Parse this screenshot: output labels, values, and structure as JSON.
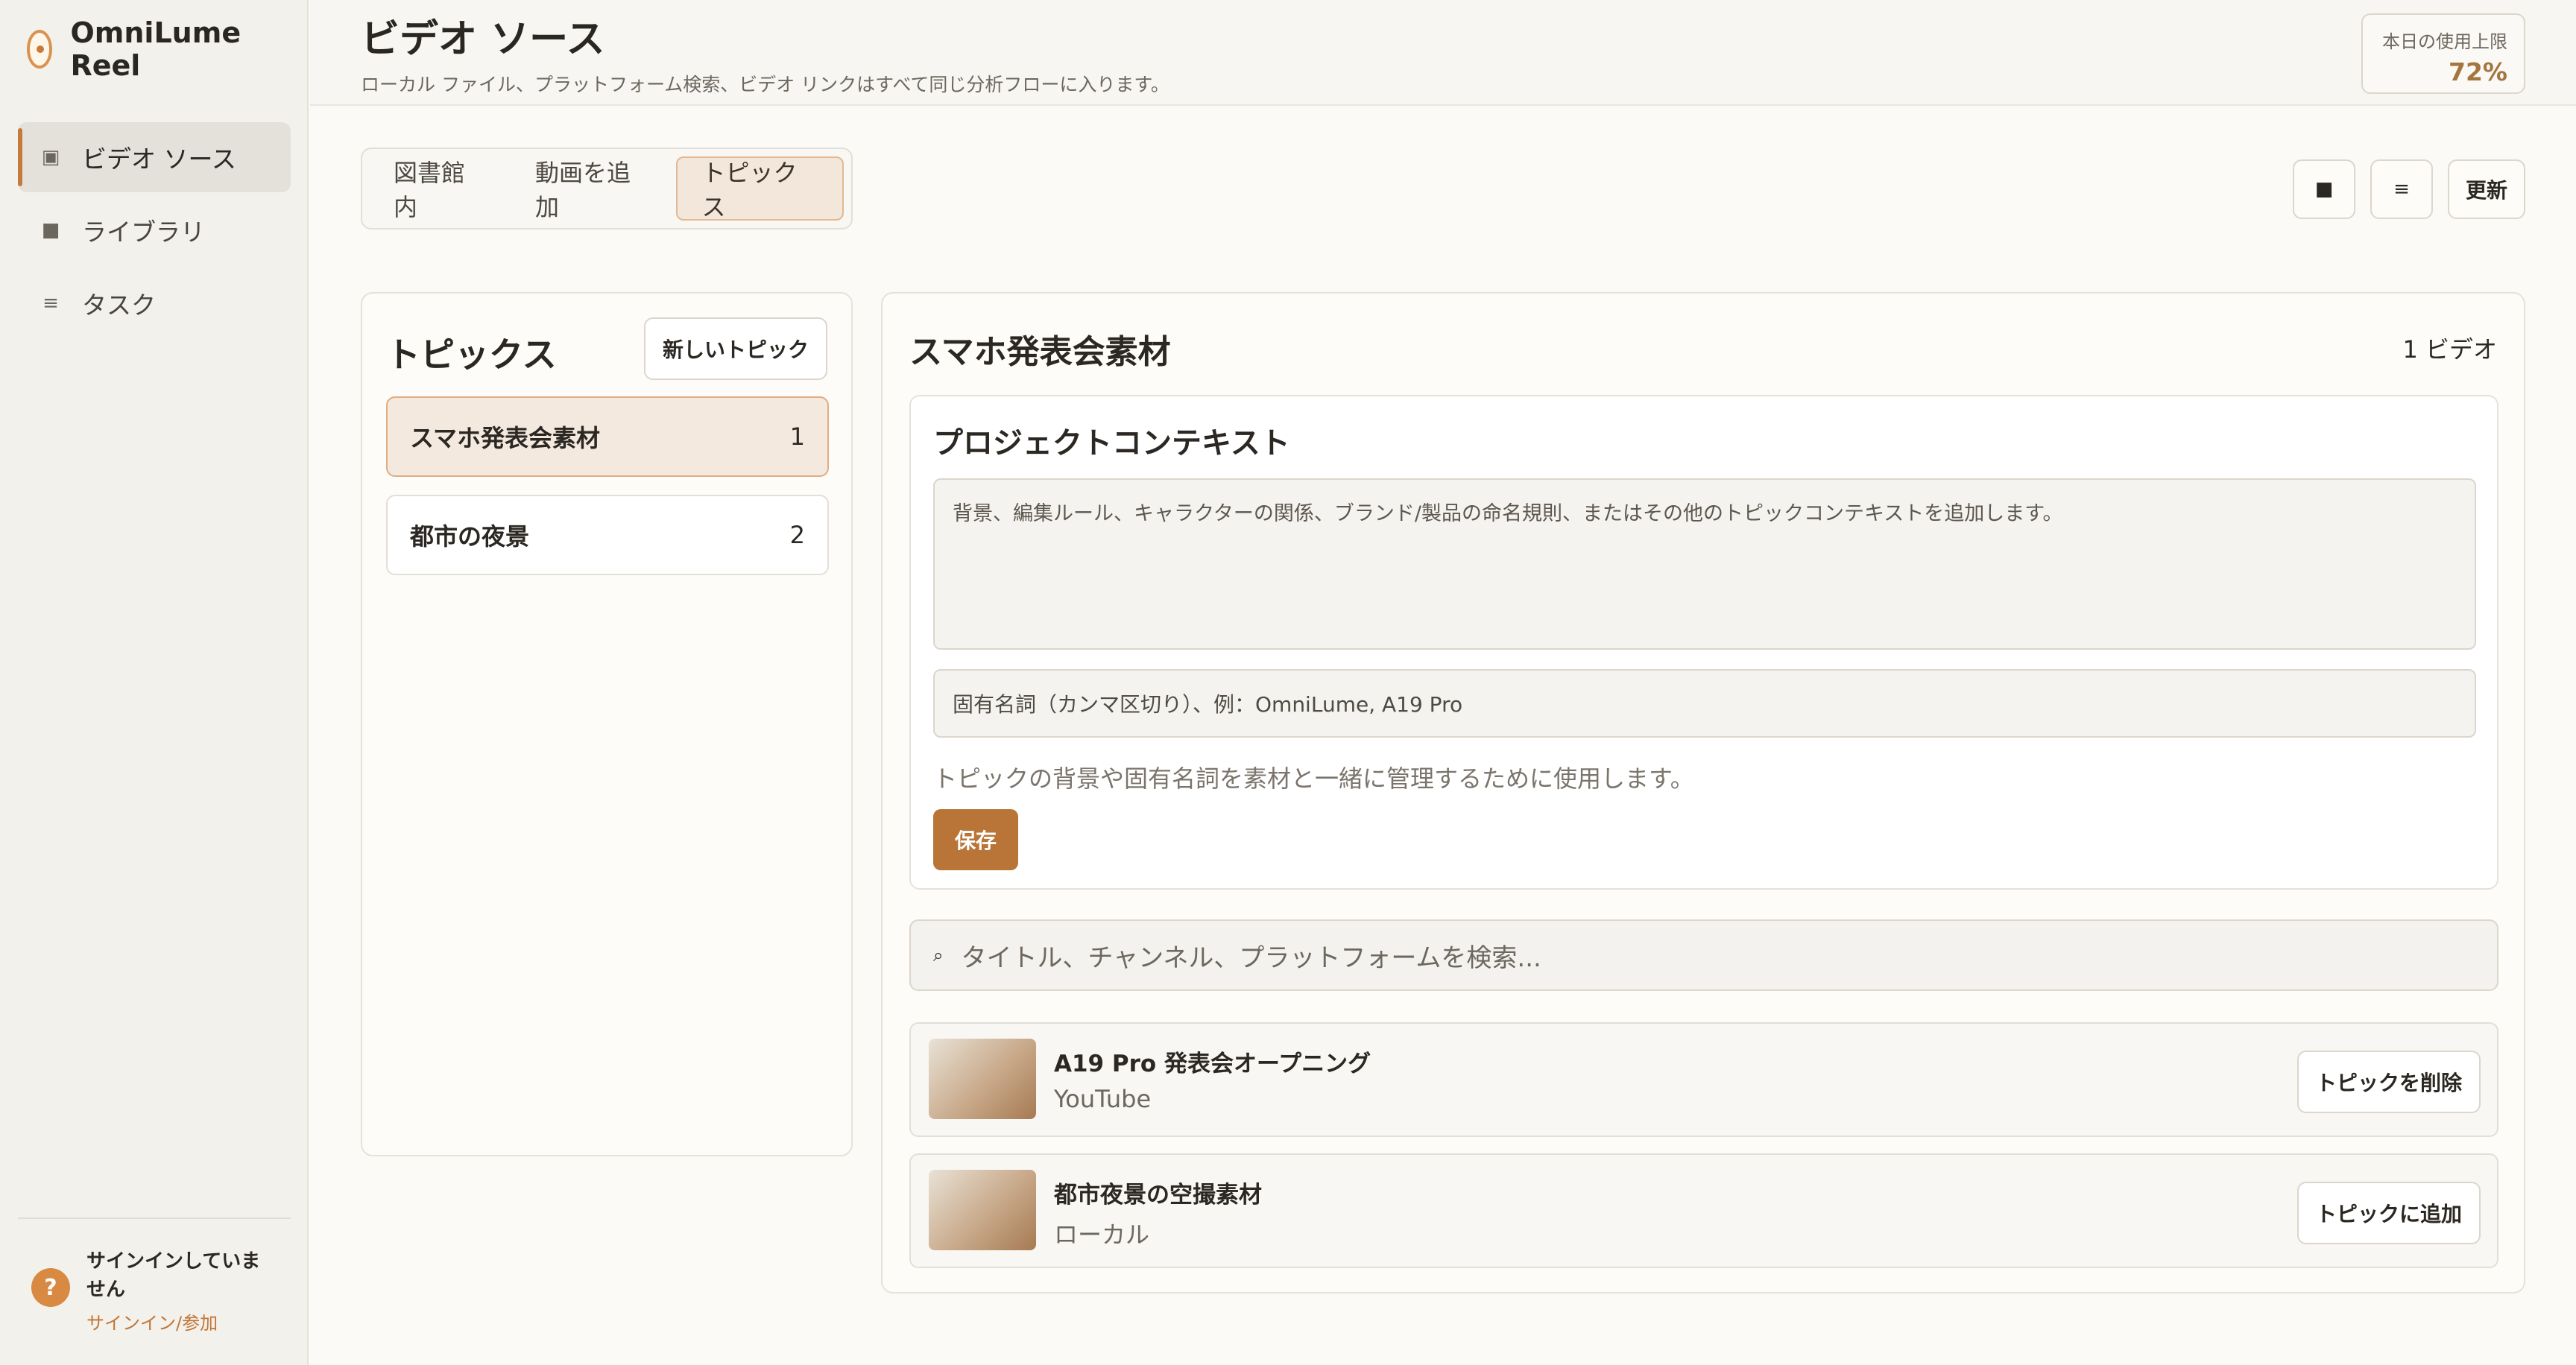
{
  "app": {
    "name": "OmniLume Reel"
  },
  "sidebar": {
    "items": [
      {
        "label": "ビデオ ソース",
        "icon": "▣"
      },
      {
        "label": "ライブラリ",
        "icon": "■"
      },
      {
        "label": "タスク",
        "icon": "≡"
      }
    ],
    "footer": {
      "status": "サインインしていません",
      "link": "サインイン/参加",
      "help_icon": "?"
    }
  },
  "header": {
    "title": "ビデオ ソース",
    "subtitle": "ローカル ファイル、プラットフォーム検索、ビデオ リンクはすべて同じ分析フローに入ります。",
    "quota_label": "本日の使用上限",
    "quota_value": "72%"
  },
  "tabs": [
    "図書館内",
    "動画を追加",
    "トピックス"
  ],
  "toolbar": {
    "grid_icon": "■",
    "list_icon": "≡",
    "refresh_label": "更新"
  },
  "topics": {
    "title": "トピックス",
    "new_button": "新しいトピック",
    "items": [
      {
        "name": "スマホ発表会素材",
        "count": "1"
      },
      {
        "name": "都市の夜景",
        "count": "2"
      }
    ]
  },
  "detail": {
    "title": "スマホ発表会素材",
    "video_count": "1 ビデオ",
    "context": {
      "title": "プロジェクトコンテキスト",
      "textarea_placeholder": "背景、編集ルール、キャラクターの関係、ブランド/製品の命名規則、またはその他のトピックコンテキストを追加します。",
      "names_placeholder": "固有名詞（カンマ区切り）、例：OmniLume, A19 Pro",
      "help": "トピックの背景や固有名詞を素材と一緒に管理するために使用します。",
      "save": "保存"
    },
    "search_icon": "⌕",
    "search_placeholder": "タイトル、チャンネル、プラットフォームを検索...",
    "videos": [
      {
        "title": "A19 Pro 発表会オープニング",
        "source": "YouTube",
        "action": "トピックを削除"
      },
      {
        "title": "都市夜景の空撮素材",
        "source": "ローカル",
        "action": "トピックに追加"
      }
    ]
  },
  "colors": {
    "accent": "#b97537",
    "active_tab_bg": "#f3e6da",
    "quota_value": "#a3763f"
  }
}
